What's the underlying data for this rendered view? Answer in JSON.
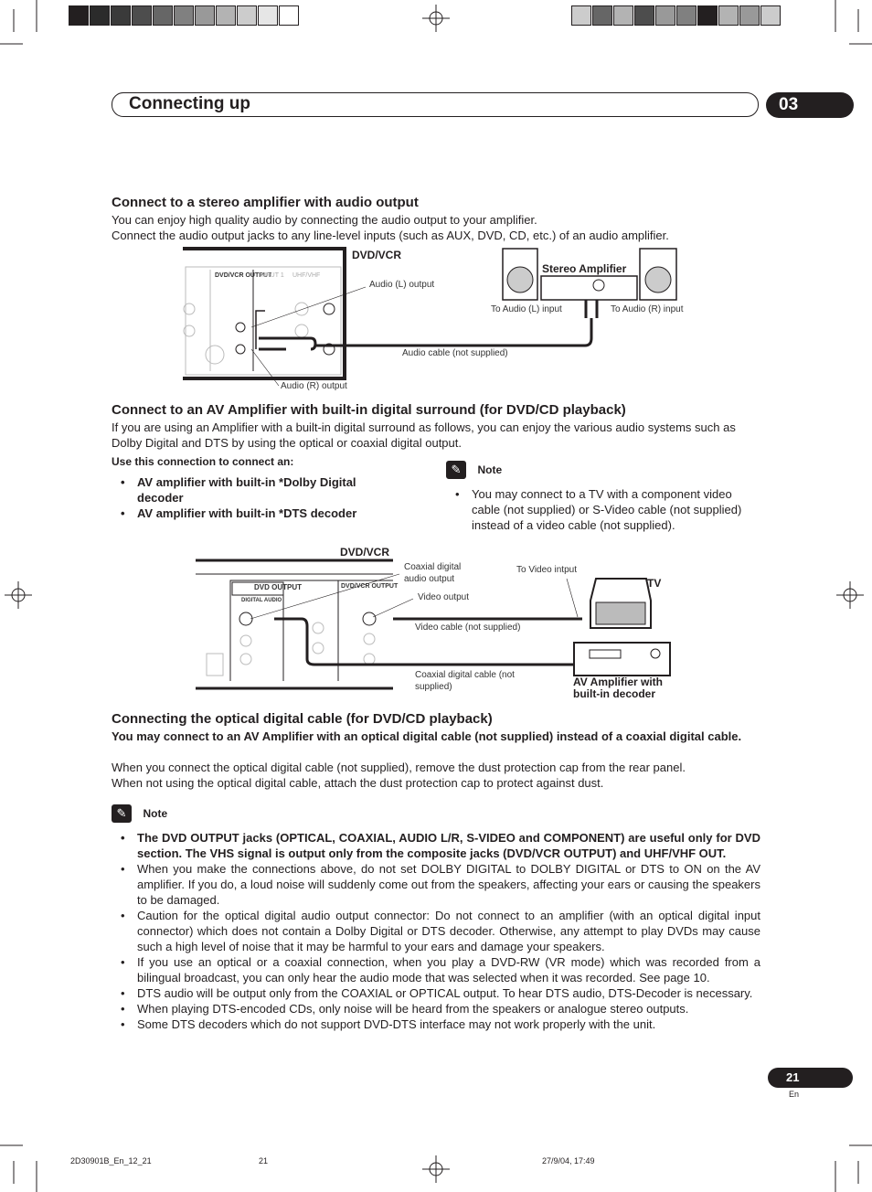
{
  "header": {
    "section_title": "Connecting up",
    "chapter": "03"
  },
  "colors": {
    "ink": "#231f20",
    "top_bar_left": [
      "#231f20",
      "#2b2b2b",
      "#3a3a3a",
      "#4d4d4d",
      "#666666",
      "#808080",
      "#999999",
      "#b3b3b3",
      "#cccccc",
      "#e6e6e6",
      "#ffffff"
    ],
    "top_bar_right": [
      "#cccccc",
      "#666666",
      "#b3b3b3",
      "#4d4d4d",
      "#999999",
      "#808080",
      "#231f20",
      "#b3b3b3",
      "#999999",
      "#cccccc"
    ]
  },
  "section1": {
    "heading": "Connect to a stereo amplifier with audio output",
    "paragraphs": [
      "You can enjoy high quality audio by connecting the audio output to your amplifier.",
      "Connect the audio output jacks to any line-level inputs (such as AUX, DVD, CD, etc.) of an audio amplifier."
    ],
    "diagram": {
      "device": "DVD/VCR",
      "panel_labels": [
        "DVD/VCR OUTPUT",
        "INPUT 1",
        "UHF/VHF"
      ],
      "audio_l": "Audio (L) output",
      "audio_r": "Audio (R) output",
      "amp": "Stereo Amplifier",
      "to_l": "To Audio (L) input",
      "to_r": "To Audio (R) input",
      "cable": "Audio cable (not supplied)"
    }
  },
  "section2": {
    "heading": "Connect to an AV Amplifier with built-in digital surround (for DVD/CD playback)",
    "paragraph": "If you are using an Amplifier with a built-in digital surround as follows, you can enjoy the various audio systems such as Dolby Digital and DTS by using the optical or coaxial digital output.",
    "use_label": "Use this connection to connect an:",
    "bullets": [
      "AV amplifier with built-in *Dolby Digital decoder",
      "AV amplifier with built-in *DTS decoder"
    ],
    "note": {
      "title": "Note",
      "items": [
        "You may connect to a TV with a component video cable (not supplied) or S-Video cable (not supplied) instead of a video cable (not supplied)."
      ]
    },
    "diagram": {
      "device": "DVD/VCR",
      "panel_labels": [
        "DVD OUTPUT",
        "DIGITAL AUDIO",
        "DVD/VCR OUTPUT"
      ],
      "coax_out": "Coaxial digital audio output",
      "video_out": "Video output",
      "to_video": "To Video intput",
      "tv": "TV",
      "video_cable": "Video cable (not supplied)",
      "coax_cable": "Coaxial digital cable (not supplied)",
      "amp": "AV Amplifier with built-in decoder"
    }
  },
  "section3": {
    "heading": "Connecting the optical digital cable (for DVD/CD playback)",
    "bold_para": "You may connect to an AV Amplifier with an optical digital cable (not supplied) instead of a coaxial digital cable.",
    "paragraphs": [
      "When you connect the optical digital cable (not supplied), remove the dust protection cap from the rear panel.",
      "When not using the optical digital cable, attach the dust protection cap to protect against dust."
    ],
    "note": {
      "title": "Note",
      "items": [
        "The DVD OUTPUT jacks (OPTICAL, COAXIAL, AUDIO L/R, S-VIDEO and COMPONENT) are useful only for DVD section. The VHS signal is output only from the composite jacks (DVD/VCR  OUTPUT) and UHF/VHF OUT.",
        "When you make the connections above, do not set DOLBY DIGITAL to DOLBY DIGITAL or DTS to ON on the AV amplifier. If you do, a loud noise will suddenly come out from the speakers, affecting your ears or causing the speakers to be damaged.",
        "Caution for the optical digital audio output connector: Do not connect to an amplifier (with an optical digital input connector) which does not contain a Dolby Digital or DTS decoder. Otherwise, any attempt to play DVDs may cause such a high level of noise that it may be harmful to your ears and damage your speakers.",
        "If you use an optical or a coaxial connection, when you play a DVD-RW (VR mode) which was recorded from a bilingual broadcast, you can only hear the audio mode that was selected when it was recorded. See page 10.",
        "DTS audio will be output only from the COAXIAL or OPTICAL output. To hear DTS audio, DTS-Decoder is necessary.",
        "When playing DTS-encoded CDs, only noise will be heard from the speakers or analogue stereo outputs.",
        "Some DTS decoders which do not support DVD-DTS interface may not work properly with the unit."
      ]
    }
  },
  "page": {
    "number": "21",
    "lang": "En"
  },
  "footer": {
    "file": "2D30901B_En_12_21",
    "page": "21",
    "date": "27/9/04, 17:49"
  }
}
